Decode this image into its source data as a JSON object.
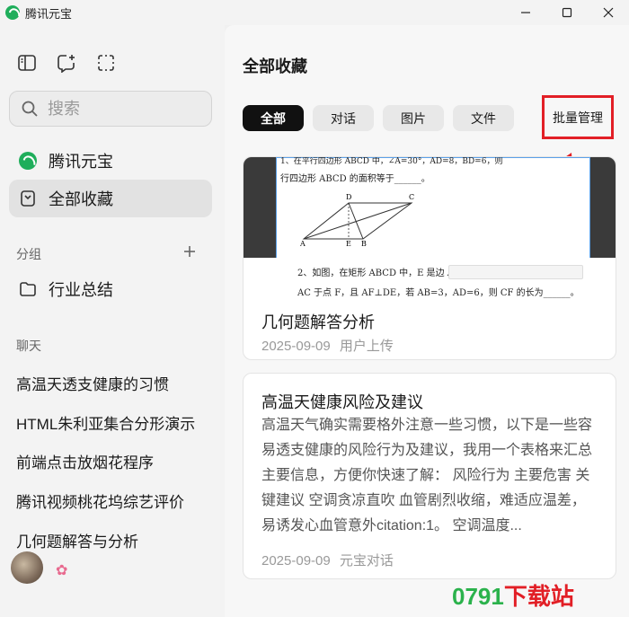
{
  "window": {
    "title": "腾讯元宝"
  },
  "sidebar": {
    "search_placeholder": "搜索",
    "nav": [
      {
        "label": "腾讯元宝",
        "icon": "yuanbao-logo-icon"
      },
      {
        "label": "全部收藏",
        "icon": "bookmark-icon",
        "active": true
      }
    ],
    "groups_label": "分组",
    "groups": [
      {
        "label": "行业总结",
        "icon": "folder-icon"
      }
    ],
    "chats_label": "聊天",
    "chats": [
      "高温天透支健康的习惯",
      "HTML朱利亚集合分形演示",
      "前端点击放烟花程序",
      "腾讯视频桃花坞综艺评价",
      "几何题解答与分析"
    ],
    "user_badge": "✿"
  },
  "main": {
    "title": "全部收藏",
    "tabs": [
      {
        "label": "全部",
        "active": true
      },
      {
        "label": "对话"
      },
      {
        "label": "图片"
      },
      {
        "label": "文件"
      }
    ],
    "batch_manage_label": "批量管理",
    "cards": [
      {
        "title": "几何题解答分析",
        "date": "2025-09-09",
        "source": "用户上传",
        "thumb": {
          "line1": "1、在平行四边形 ABCD 中，∠A=30°，AD=8，BD=6，则",
          "line2": "行四边形 ABCD 的面积等于______。",
          "line3": "2、如图，在矩形 ABCD 中，E 是边 AD",
          "line4": "AC 于点 F，且 AF⊥DE，若 AB=3，AD=6，则 CF 的长为______。",
          "labels": [
            "D",
            "C",
            "A",
            "E",
            "B"
          ]
        }
      },
      {
        "title": "高温天健康风险及建议",
        "body": "高温天气确实需要格外注意一些习惯，以下是一些容易透支健康的风险行为及建议，我用一个表格来汇总主要信息，方便你快速了解： 风险行为 主要危害 关键建议 空调贪凉直吹 血管剧烈收缩，难适应温差，易诱发心血管意外citation:1。 空调温度...",
        "date": "2025-09-09",
        "source": "元宝对话"
      }
    ]
  },
  "watermark": {
    "part1": "0791",
    "part2": "下载站"
  },
  "colors": {
    "accent_red": "#e21f26",
    "brand_green": "#1fae5b"
  }
}
